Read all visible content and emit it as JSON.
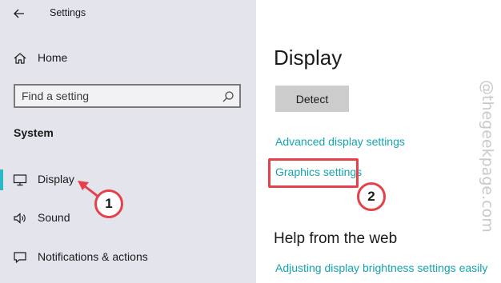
{
  "window": {
    "title": "Settings"
  },
  "sidebar": {
    "home_label": "Home",
    "search": {
      "placeholder": "Find a setting"
    },
    "section_title": "System",
    "items": [
      {
        "label": "Display",
        "icon": "monitor-icon",
        "selected": true
      },
      {
        "label": "Sound",
        "icon": "speaker-icon",
        "selected": false
      },
      {
        "label": "Notifications & actions",
        "icon": "message-icon",
        "selected": false
      }
    ]
  },
  "main": {
    "page_title": "Display",
    "detect_button_label": "Detect",
    "links": {
      "advanced_display": "Advanced display settings",
      "graphics": "Graphics settings"
    },
    "help_heading": "Help from the web",
    "help_link": "Adjusting display brightness settings easily"
  },
  "annotations": {
    "step1": "1",
    "step2": "2",
    "color": "#e6414a"
  },
  "watermark": "@thegeekpage.com",
  "colors": {
    "accent": "#2bb8c6",
    "link": "#14a4b0",
    "sidebar_bg": "#e4e4ec",
    "annotation": "#e6414a"
  }
}
